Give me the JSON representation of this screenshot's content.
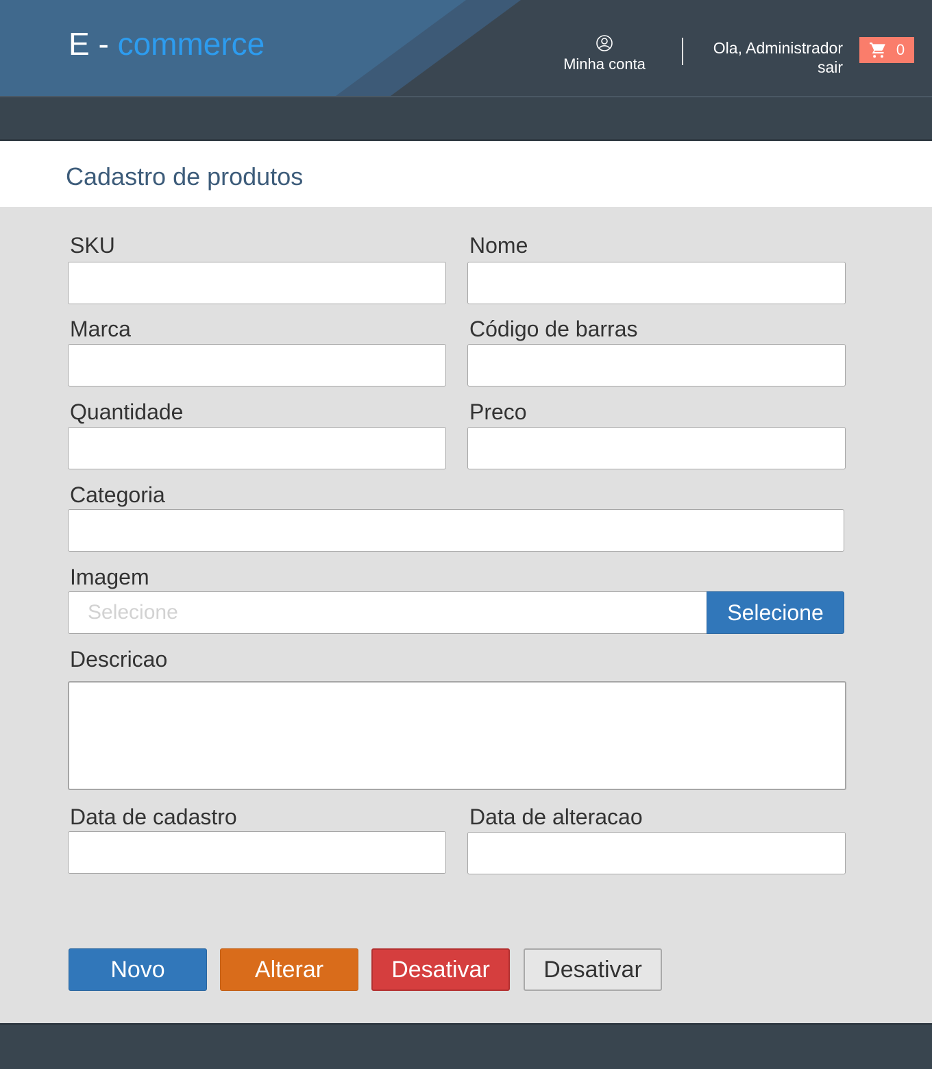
{
  "header": {
    "logo_part1": "E - ",
    "logo_part2": "commerce",
    "account_icon": "user-circle-icon",
    "account_label": "Minha conta",
    "greeting": "Ola, Administrador",
    "logout": "sair",
    "cart_icon": "cart-icon",
    "cart_count": "0"
  },
  "colors": {
    "header_bg": "#3a4651",
    "logo_accent": "#2d9cef",
    "title": "#3d5c7a",
    "cart": "#fa7d6b",
    "primary": "#3177ba",
    "warning": "#d96c1b",
    "danger": "#d53e3e"
  },
  "page": {
    "title": "Cadastro de produtos"
  },
  "form": {
    "sku_label": "SKU",
    "sku_value": "",
    "nome_label": "Nome",
    "nome_value": "",
    "marca_label": "Marca",
    "marca_value": "",
    "codigo_label": "Código de barras",
    "codigo_value": "",
    "quantidade_label": "Quantidade",
    "quantidade_value": "",
    "preco_label": "Preco",
    "preco_value": "",
    "categoria_label": "Categoria",
    "categoria_value": "",
    "imagem_label": "Imagem",
    "imagem_placeholder": "Selecione",
    "imagem_button": "Selecione",
    "descricao_label": "Descricao",
    "descricao_value": "",
    "data_cadastro_label": "Data de cadastro",
    "data_cadastro_value": "",
    "data_alteracao_label": "Data de alteracao",
    "data_alteracao_value": ""
  },
  "actions": {
    "novo": "Novo",
    "alterar": "Alterar",
    "desativar": "Desativar",
    "desativar_secondary": "Desativar"
  }
}
